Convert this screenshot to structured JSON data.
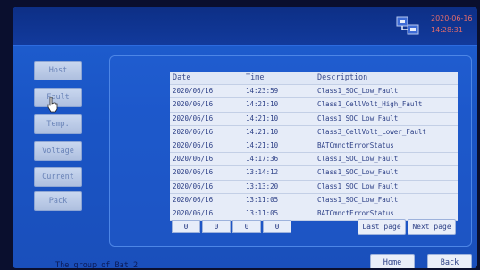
{
  "status": {
    "datetime_line1": "2020-06-16",
    "datetime_line2": "14:28:31"
  },
  "sidebar": {
    "items": [
      {
        "label": "Host"
      },
      {
        "label": "Fault"
      },
      {
        "label": "Temp."
      },
      {
        "label": "Voltage"
      },
      {
        "label": "Current"
      },
      {
        "label": "Pack"
      }
    ]
  },
  "table": {
    "headers": [
      "Date",
      "Time",
      "Description"
    ],
    "rows": [
      [
        "2020/06/16",
        "14:23:59",
        "Class1_SOC_Low_Fault"
      ],
      [
        "2020/06/16",
        "14:21:10",
        "Class1_CellVolt_High_Fault"
      ],
      [
        "2020/06/16",
        "14:21:10",
        "Class1_SOC_Low_Fault"
      ],
      [
        "2020/06/16",
        "14:21:10",
        "Class3_CellVolt_Lower_Fault"
      ],
      [
        "2020/06/16",
        "14:21:10",
        "BATCmnctErrorStatus"
      ],
      [
        "2020/06/16",
        "14:17:36",
        "Class1_SOC_Low_Fault"
      ],
      [
        "2020/06/16",
        "13:14:12",
        "Class1_SOC_Low_Fault"
      ],
      [
        "2020/06/16",
        "13:13:20",
        "Class1_SOC_Low_Fault"
      ],
      [
        "2020/06/16",
        "13:11:05",
        "Class1_SOC_Low_Fault"
      ],
      [
        "2020/06/16",
        "13:11:05",
        "BATCmnctErrorStatus"
      ]
    ]
  },
  "pagination": {
    "fields": [
      "0",
      "0",
      "0",
      "0"
    ],
    "last_page": "Last page",
    "next_page": "Next page"
  },
  "footer": {
    "text": "The group of Bat 2",
    "home": "Home",
    "back": "Back"
  },
  "icons": {
    "status": "network-status-icon",
    "cursor": "hand-pointer-icon"
  },
  "colors": {
    "background": "#1a55c6",
    "topbar": "#0d2f86",
    "button": "#c9d7ef",
    "datetime": "#e06b6b",
    "table": "#e6ecf8"
  }
}
